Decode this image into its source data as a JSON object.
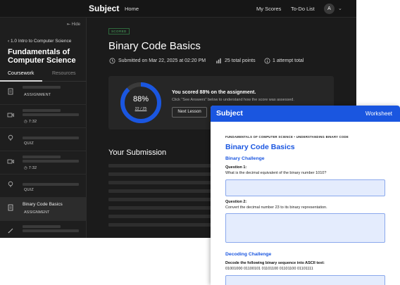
{
  "topbar": {
    "brand": "Subject",
    "home": "Home",
    "my_scores": "My Scores",
    "todo": "To-Do List",
    "avatar_initial": "A"
  },
  "sidebar": {
    "hide_label": "Hide",
    "back_link": "1.0 Intro to Computer Science",
    "course_title": "Fundamentals of Computer Science",
    "tabs": [
      "Coursework",
      "Resources"
    ],
    "items": [
      {
        "type": "document-icon",
        "label": "ASSIGNMENT"
      },
      {
        "type": "video-icon",
        "label": "7:32"
      },
      {
        "type": "lightbulb-icon",
        "label": "QUIZ"
      },
      {
        "type": "video-icon",
        "label": "7:32"
      },
      {
        "type": "lightbulb-icon",
        "label": "QUIZ"
      },
      {
        "type": "document-icon",
        "title": "Binary Code Basics",
        "label": "ASSIGNMENT"
      },
      {
        "type": "pencil-icon",
        "label": ""
      }
    ]
  },
  "main": {
    "badge": "SCORED",
    "title": "Binary Code Basics",
    "submitted": "Submitted on Mar 22, 2025 at 02:20 PM",
    "points": "25 total points",
    "attempts": "1 attempt total",
    "score": {
      "percent": "88%",
      "fraction": "22 / 25",
      "value": 0.88,
      "message": "You scored 88% on the assignment.",
      "sub": "Click \"See Answers\" below to understand how the score was assessed.",
      "next_button": "Next Lesson"
    },
    "submission_heading": "Your Submission"
  },
  "worksheet": {
    "brand": "Subject",
    "label": "Worksheet",
    "crumb": "FUNDAMENTALS OF COMPUTER SCIENCE • UNDERSTANDING BINARY CODE",
    "title": "Binary Code Basics",
    "section1": "Binary Challenge",
    "q1_label": "Question 1:",
    "q1_text": "What is the decimal equivalent of the binary number 1010?",
    "q2_label": "Question 2:",
    "q2_text": "Convert the decimal number 23 to its binary representation.",
    "section2": "Decoding Challenge",
    "decode_label": "Decode the following binary sequence into ASCII text:",
    "decode_seq": "01001000 01100101 01101100 01101100 01101111"
  },
  "colors": {
    "accent": "#1a56e0",
    "dark_bg": "#1b1b1b",
    "scored": "#4caf63"
  }
}
